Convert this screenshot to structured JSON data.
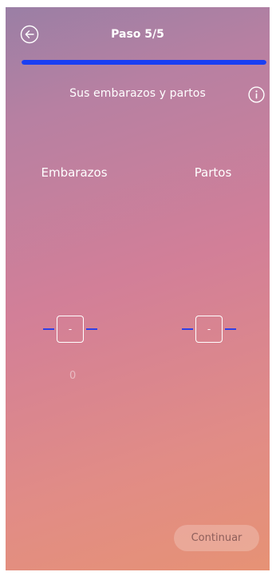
{
  "header": {
    "back_icon": "arrow-left-circle-icon",
    "step_label": "Paso 5/5",
    "progress_percent": 100,
    "progress_color": "#1a3ff2"
  },
  "section": {
    "title": "Sus embarazos y partos",
    "info_icon": "info-circle-icon"
  },
  "columns": {
    "embarazos": {
      "label": "Embarazos",
      "value": "-",
      "count": "0"
    },
    "partos": {
      "label": "Partos",
      "value": "-"
    }
  },
  "footer": {
    "continue_label": "Continuar"
  },
  "colors": {
    "gradient_top": "#9a7fa5",
    "gradient_mid": "#d27f98",
    "gradient_bottom": "#e69275",
    "stepper_dash": "#2f3fe6"
  }
}
